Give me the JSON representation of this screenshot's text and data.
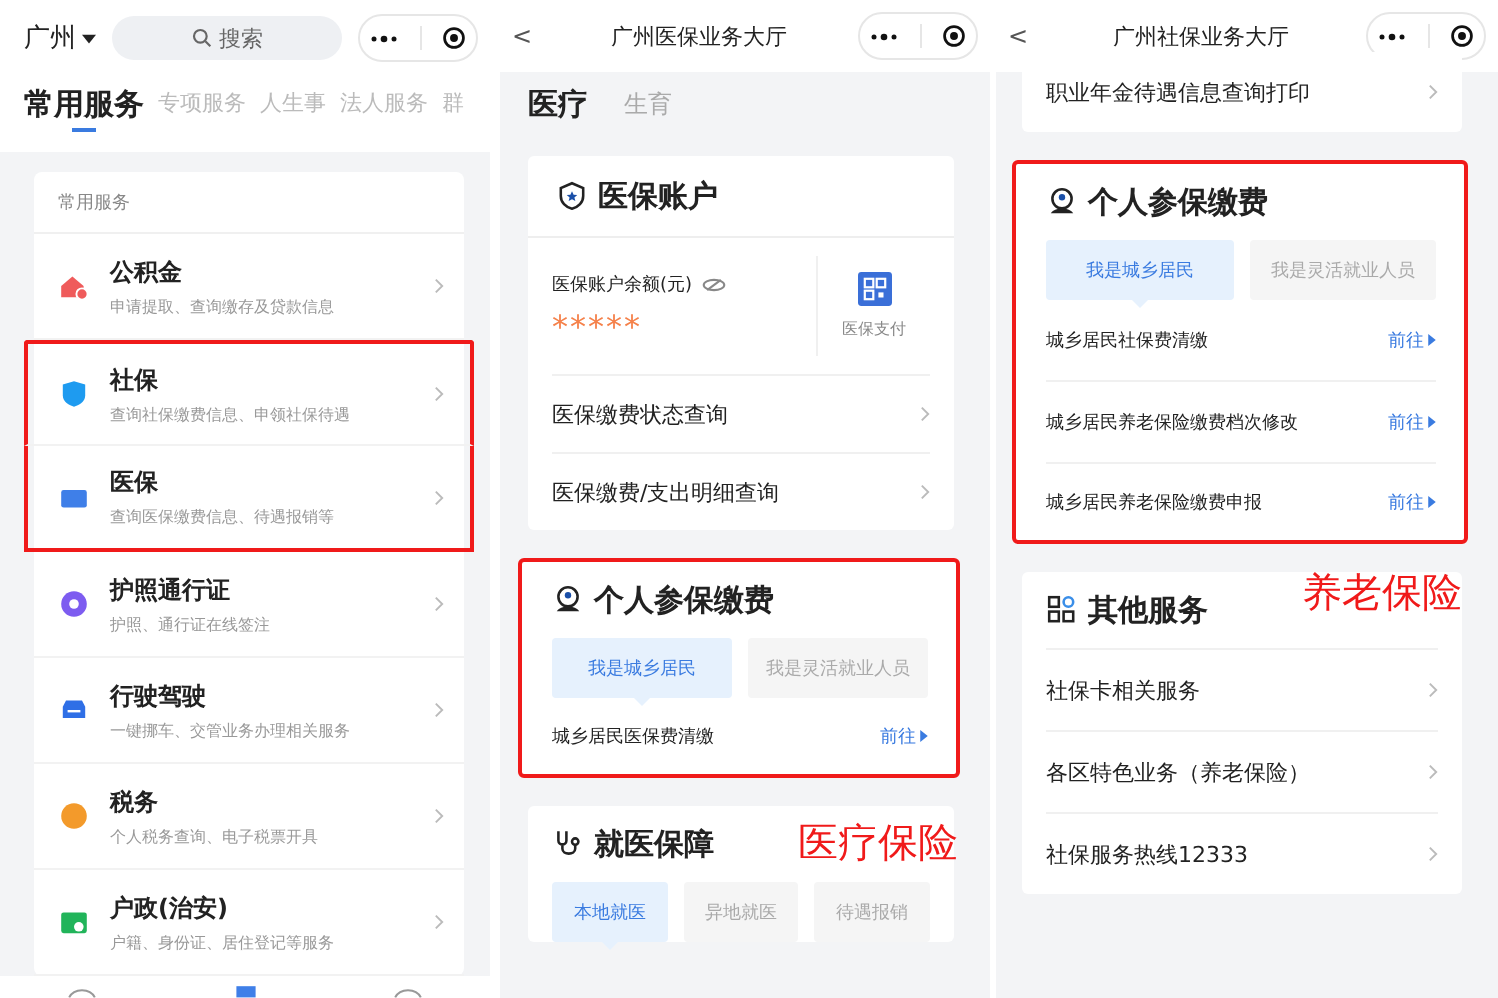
{
  "home": {
    "city": "广州",
    "search": {
      "placeholder": "搜索"
    },
    "tabs": [
      {
        "label": "常用服务",
        "selected": true
      },
      {
        "label": "专项服务",
        "selected": false
      },
      {
        "label": "人生事",
        "selected": false
      },
      {
        "label": "法人服务",
        "selected": false
      },
      {
        "label": "群",
        "selected": false
      }
    ],
    "section_title": "常用服务",
    "services": [
      {
        "title": "公积金",
        "subtitle": "申请提取、查询缴存及贷款信息",
        "highlighted": false
      },
      {
        "title": "社保",
        "subtitle": "查询社保缴费信息、申领社保待遇",
        "highlighted": true
      },
      {
        "title": "医保",
        "subtitle": "查询医保缴费信息、待遇报销等",
        "highlighted": true
      },
      {
        "title": "护照通行证",
        "subtitle": "护照、通行证在线签注",
        "highlighted": false
      },
      {
        "title": "行驶驾驶",
        "subtitle": "一键挪车、交管业务办理相关服务",
        "highlighted": false
      },
      {
        "title": "税务",
        "subtitle": "个人税务查询、电子税票开具",
        "highlighted": false
      },
      {
        "title": "户政(治安)",
        "subtitle": "户籍、身份证、居住登记等服务",
        "highlighted": false
      }
    ]
  },
  "medical_hall": {
    "title": "广州医保业务大厅",
    "back": "<",
    "tabs": [
      {
        "label": "医疗",
        "selected": true
      },
      {
        "label": "生育",
        "selected": false
      }
    ],
    "cards": [
      {
        "kind": "account",
        "title": "医保账户",
        "balance_label": "医保账户余额(元)",
        "balance": "*****",
        "pay_label": "医保支付",
        "links": [
          "医保缴费状态查询",
          "医保缴费/支出明细查询"
        ]
      },
      {
        "kind": "payment",
        "title": "个人参保缴费",
        "highlighted": true,
        "options": [
          {
            "label": "我是城乡居民",
            "selected": true
          },
          {
            "label": "我是灵活就业人员",
            "selected": false
          }
        ],
        "rows": [
          {
            "label": "城乡居民医保费清缴",
            "action": "前往"
          }
        ],
        "annotation": "医疗保险"
      },
      {
        "kind": "coverage",
        "title": "就医保障",
        "highlighted": false,
        "options": [
          {
            "label": "本地就医",
            "selected": true
          },
          {
            "label": "异地就医",
            "selected": false
          },
          {
            "label": "待遇报销",
            "selected": false
          }
        ]
      }
    ]
  },
  "social_hall": {
    "title": "广州社保业务大厅",
    "back": "<",
    "cards": [
      {
        "kind": "links",
        "links": [
          "职业年金待遇信息查询打印"
        ]
      },
      {
        "kind": "payment",
        "title": "个人参保缴费",
        "highlighted": true,
        "options": [
          {
            "label": "我是城乡居民",
            "selected": true
          },
          {
            "label": "我是灵活就业人员",
            "selected": false
          }
        ],
        "rows": [
          {
            "label": "城乡居民社保费清缴",
            "action": "前往"
          },
          {
            "label": "城乡居民养老保险缴费档次修改",
            "action": "前往"
          },
          {
            "label": "城乡居民养老保险缴费申报",
            "action": "前往"
          }
        ],
        "annotation": "养老保险"
      },
      {
        "kind": "services",
        "title": "其他服务",
        "links": [
          "社保卡相关服务",
          "各区特色业务（养老保险）",
          "社保服务热线12333"
        ]
      }
    ]
  }
}
